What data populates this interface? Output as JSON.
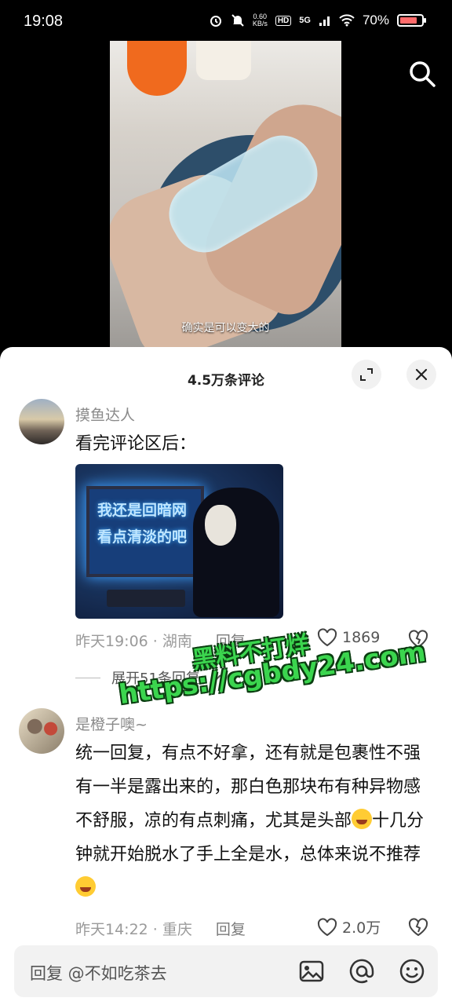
{
  "status_bar": {
    "time": "19:08",
    "net_speed_value": "0.60",
    "net_speed_unit": "KB/s",
    "hd": "HD",
    "signal": "5G",
    "battery": "70%"
  },
  "video": {
    "subtitle": "确实是可以变大的"
  },
  "comments_panel": {
    "title": "4.5万条评论",
    "comments": [
      {
        "username": "摸鱼达人",
        "text": "看完评论区后：",
        "image_text_line1": "我还是回暗网",
        "image_text_line2": "看点清淡的吧",
        "time_location": "昨天19:06 · 湖南",
        "reply": "回复",
        "likes": "1869",
        "expand_replies": "展开51条回复"
      },
      {
        "username": "是橙子噢~",
        "text_before_emoji": "统一回复，有点不好拿，还有就是包裹性不强有一半是露出来的，那白色那块布有种异物感不舒服，凉的有点刺痛，尤其是头部",
        "text_middle": "十几分钟就开始脱水了手上全是水，总体来说不推荐",
        "time_location": "昨天14:22 · 重庆",
        "reply": "回复",
        "likes": "2.0万"
      }
    ]
  },
  "watermark": {
    "line1": "黑料不打烊",
    "line2": "https://cgbdy24.com"
  },
  "input_bar": {
    "placeholder": "回复 @不如吃茶去"
  },
  "icons": {
    "search": "search-icon",
    "expand": "expand-icon",
    "close": "close-icon",
    "like": "heart-icon",
    "dislike": "broken-heart-icon",
    "image": "image-icon",
    "mention": "at-icon",
    "emoji": "emoji-icon"
  },
  "colors": {
    "panel_bg": "#ffffff",
    "watermark_green": "#3bd54e",
    "battery_fill": "#ff6b6b"
  }
}
